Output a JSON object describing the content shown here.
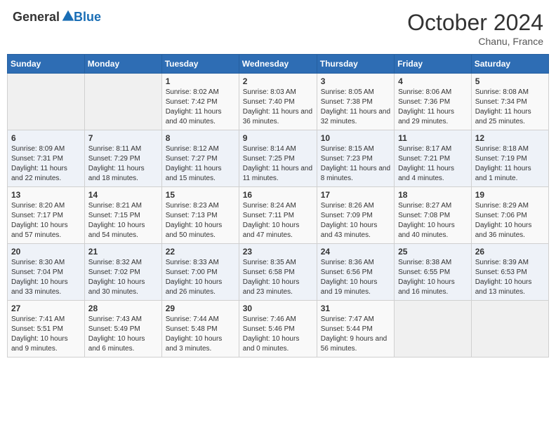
{
  "header": {
    "logo_general": "General",
    "logo_blue": "Blue",
    "month_title": "October 2024",
    "location": "Chanu, France"
  },
  "calendar": {
    "days_of_week": [
      "Sunday",
      "Monday",
      "Tuesday",
      "Wednesday",
      "Thursday",
      "Friday",
      "Saturday"
    ],
    "weeks": [
      [
        {
          "day": "",
          "info": ""
        },
        {
          "day": "",
          "info": ""
        },
        {
          "day": "1",
          "info": "Sunrise: 8:02 AM\nSunset: 7:42 PM\nDaylight: 11 hours and 40 minutes."
        },
        {
          "day": "2",
          "info": "Sunrise: 8:03 AM\nSunset: 7:40 PM\nDaylight: 11 hours and 36 minutes."
        },
        {
          "day": "3",
          "info": "Sunrise: 8:05 AM\nSunset: 7:38 PM\nDaylight: 11 hours and 32 minutes."
        },
        {
          "day": "4",
          "info": "Sunrise: 8:06 AM\nSunset: 7:36 PM\nDaylight: 11 hours and 29 minutes."
        },
        {
          "day": "5",
          "info": "Sunrise: 8:08 AM\nSunset: 7:34 PM\nDaylight: 11 hours and 25 minutes."
        }
      ],
      [
        {
          "day": "6",
          "info": "Sunrise: 8:09 AM\nSunset: 7:31 PM\nDaylight: 11 hours and 22 minutes."
        },
        {
          "day": "7",
          "info": "Sunrise: 8:11 AM\nSunset: 7:29 PM\nDaylight: 11 hours and 18 minutes."
        },
        {
          "day": "8",
          "info": "Sunrise: 8:12 AM\nSunset: 7:27 PM\nDaylight: 11 hours and 15 minutes."
        },
        {
          "day": "9",
          "info": "Sunrise: 8:14 AM\nSunset: 7:25 PM\nDaylight: 11 hours and 11 minutes."
        },
        {
          "day": "10",
          "info": "Sunrise: 8:15 AM\nSunset: 7:23 PM\nDaylight: 11 hours and 8 minutes."
        },
        {
          "day": "11",
          "info": "Sunrise: 8:17 AM\nSunset: 7:21 PM\nDaylight: 11 hours and 4 minutes."
        },
        {
          "day": "12",
          "info": "Sunrise: 8:18 AM\nSunset: 7:19 PM\nDaylight: 11 hours and 1 minute."
        }
      ],
      [
        {
          "day": "13",
          "info": "Sunrise: 8:20 AM\nSunset: 7:17 PM\nDaylight: 10 hours and 57 minutes."
        },
        {
          "day": "14",
          "info": "Sunrise: 8:21 AM\nSunset: 7:15 PM\nDaylight: 10 hours and 54 minutes."
        },
        {
          "day": "15",
          "info": "Sunrise: 8:23 AM\nSunset: 7:13 PM\nDaylight: 10 hours and 50 minutes."
        },
        {
          "day": "16",
          "info": "Sunrise: 8:24 AM\nSunset: 7:11 PM\nDaylight: 10 hours and 47 minutes."
        },
        {
          "day": "17",
          "info": "Sunrise: 8:26 AM\nSunset: 7:09 PM\nDaylight: 10 hours and 43 minutes."
        },
        {
          "day": "18",
          "info": "Sunrise: 8:27 AM\nSunset: 7:08 PM\nDaylight: 10 hours and 40 minutes."
        },
        {
          "day": "19",
          "info": "Sunrise: 8:29 AM\nSunset: 7:06 PM\nDaylight: 10 hours and 36 minutes."
        }
      ],
      [
        {
          "day": "20",
          "info": "Sunrise: 8:30 AM\nSunset: 7:04 PM\nDaylight: 10 hours and 33 minutes."
        },
        {
          "day": "21",
          "info": "Sunrise: 8:32 AM\nSunset: 7:02 PM\nDaylight: 10 hours and 30 minutes."
        },
        {
          "day": "22",
          "info": "Sunrise: 8:33 AM\nSunset: 7:00 PM\nDaylight: 10 hours and 26 minutes."
        },
        {
          "day": "23",
          "info": "Sunrise: 8:35 AM\nSunset: 6:58 PM\nDaylight: 10 hours and 23 minutes."
        },
        {
          "day": "24",
          "info": "Sunrise: 8:36 AM\nSunset: 6:56 PM\nDaylight: 10 hours and 19 minutes."
        },
        {
          "day": "25",
          "info": "Sunrise: 8:38 AM\nSunset: 6:55 PM\nDaylight: 10 hours and 16 minutes."
        },
        {
          "day": "26",
          "info": "Sunrise: 8:39 AM\nSunset: 6:53 PM\nDaylight: 10 hours and 13 minutes."
        }
      ],
      [
        {
          "day": "27",
          "info": "Sunrise: 7:41 AM\nSunset: 5:51 PM\nDaylight: 10 hours and 9 minutes."
        },
        {
          "day": "28",
          "info": "Sunrise: 7:43 AM\nSunset: 5:49 PM\nDaylight: 10 hours and 6 minutes."
        },
        {
          "day": "29",
          "info": "Sunrise: 7:44 AM\nSunset: 5:48 PM\nDaylight: 10 hours and 3 minutes."
        },
        {
          "day": "30",
          "info": "Sunrise: 7:46 AM\nSunset: 5:46 PM\nDaylight: 10 hours and 0 minutes."
        },
        {
          "day": "31",
          "info": "Sunrise: 7:47 AM\nSunset: 5:44 PM\nDaylight: 9 hours and 56 minutes."
        },
        {
          "day": "",
          "info": ""
        },
        {
          "day": "",
          "info": ""
        }
      ]
    ]
  }
}
